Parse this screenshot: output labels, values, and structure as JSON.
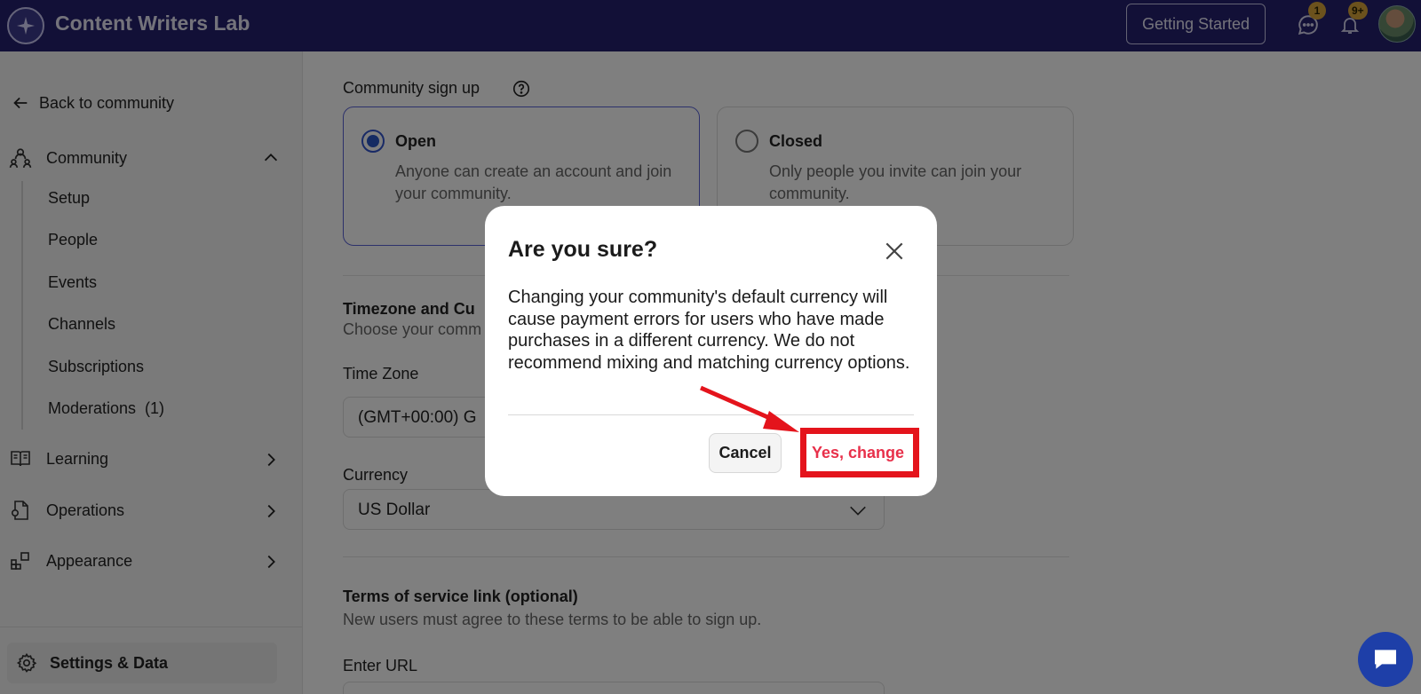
{
  "header": {
    "brand": "Content Writers Lab",
    "getting_started": "Getting Started",
    "messages_badge": "1",
    "notifications_badge": "9+"
  },
  "sidebar": {
    "back": "Back to community",
    "community": "Community",
    "sub_items": [
      "Setup",
      "People",
      "Events",
      "Channels",
      "Subscriptions",
      "Moderations  (1)"
    ],
    "learning": "Learning",
    "operations": "Operations",
    "appearance": "Appearance",
    "settings": "Settings & Data"
  },
  "main": {
    "signup_label": "Community sign up",
    "open_title": "Open",
    "open_desc": "Anyone can create an account and join your community.",
    "closed_title": "Closed",
    "closed_desc": "Only people you invite can join your community.",
    "tz_heading": "Timezone and Cu",
    "tz_desc": "Choose your comm",
    "time_zone_label": "Time Zone",
    "time_zone_value": "(GMT+00:00) G",
    "currency_label": "Currency",
    "currency_value": "US Dollar",
    "tos_heading": "Terms of service link (optional)",
    "tos_desc": "New users must agree to these terms to be able to sign up.",
    "url_label": "Enter URL"
  },
  "modal": {
    "title": "Are you sure?",
    "body": "Changing your community's default currency will cause payment errors for users who have made purchases in a different currency. We do not recommend mixing and matching currency options.",
    "cancel": "Cancel",
    "confirm": "Yes, change"
  },
  "colors": {
    "header_bg": "#24206e",
    "accent_blue": "#2a56c6",
    "confirm_text": "#e8304a",
    "highlight_red": "#e4141c",
    "badge": "#d9a43a"
  }
}
